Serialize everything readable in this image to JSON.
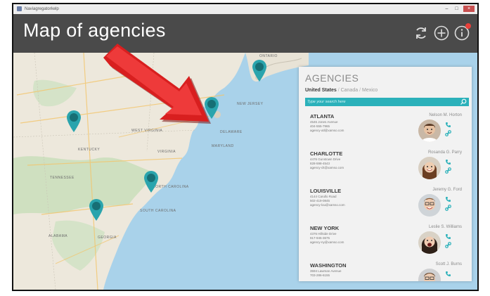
{
  "window": {
    "title": "Naviagregatorkelp"
  },
  "header": {
    "title": "Map of agencies"
  },
  "colors": {
    "accent": "#2bb1ba",
    "header_bg": "#4a4a4a",
    "pin": "#2aa4ad",
    "arrow": "#d81f1f",
    "notification": "#e8403a"
  },
  "icons": {
    "refresh": "refresh-icon",
    "add": "plus-circle-icon",
    "info": "info-icon",
    "search": "search-icon",
    "phone": "phone-icon",
    "link": "link-icon"
  },
  "map": {
    "labels": [
      "ONTARIO",
      "NEW JERSEY",
      "KENTUCKY",
      "VIRGINIA",
      "TENNESSEE",
      "SOUTH CAROLINA",
      "GEORGIA",
      "ALABAMA",
      "WEST VIRGINIA",
      "DELAWARE",
      "NORTH CAROLINA",
      "MARYLAND"
    ]
  },
  "panel": {
    "title": "AGENCIES",
    "tabs": [
      "United States",
      "Canada",
      "Mexico"
    ],
    "tab_separator": "/",
    "search_placeholder": "Type your search here",
    "agencies": [
      {
        "city": "ATLANTA",
        "address": "4546 Jones Avenue",
        "phone": "404-555-7965",
        "email": "agency-atl@xamso.com",
        "contact": "Nelson M. Horton"
      },
      {
        "city": "CHARLOTTE",
        "address": "4476 Gunstown Drive",
        "phone": "828-598-4543",
        "email": "agency-clt@xamso.com",
        "contact": "Rosanda G. Parry"
      },
      {
        "city": "LOUISVILLE",
        "address": "4144 Carullo Road",
        "phone": "502-419-0845",
        "email": "agency-lou@xamso.com",
        "contact": "Jeremy G. Ford"
      },
      {
        "city": "NEW YORK",
        "address": "4376 Hillside Drive",
        "phone": "917-945-3675",
        "email": "agency-ny@xamso.com",
        "contact": "Leslie S. Williams"
      },
      {
        "city": "WASHINGTON",
        "address": "3594 Lawman Avenue",
        "phone": "703-286-6155",
        "email": "",
        "contact": "Scott J. Burns"
      }
    ]
  }
}
